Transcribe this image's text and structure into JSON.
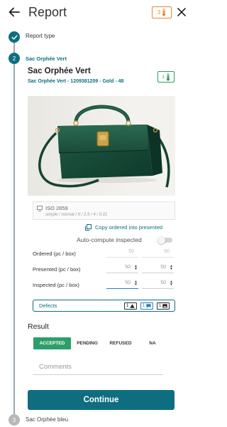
{
  "header": {
    "title": "Report",
    "badge_count": "3",
    "back_icon": "arrow-left-icon",
    "close_icon": "close-icon",
    "badge_color": "#e8892e"
  },
  "steps": [
    {
      "index": "1",
      "label": "Report type",
      "state": "done"
    },
    {
      "index": "2",
      "label": "Sac Orphée Vert",
      "state": "active"
    },
    {
      "index": "3",
      "label": "Sac Orphée bleu",
      "state": "pending"
    }
  ],
  "product": {
    "name": "Sac Orphée Vert",
    "subtitle": "Sac Orphée Vert - 1209381209 - Gold - 48",
    "badge_count": "1",
    "badge_color": "#2e9e5a",
    "image_icon": "green-handbag-image"
  },
  "iso": {
    "title": "ISO 2859",
    "details": "simple / normal / II / 2.5 / 4 / 0.01"
  },
  "copy_action": {
    "label": "Copy ordered into presented"
  },
  "auto_compute": {
    "label": "Auto-compute inspected",
    "enabled": false
  },
  "quantities": {
    "ordered": {
      "label": "Ordered (pc / box)",
      "pc": "50",
      "box": "50"
    },
    "presented": {
      "label": "Presented (pc / box)",
      "pc": "50",
      "box": "50"
    },
    "inspected": {
      "label": "Inspected (pc / box)",
      "pc": "50",
      "box": "50"
    }
  },
  "defects": {
    "label": "Defects",
    "buttons": [
      {
        "count": "1",
        "icon": "warning-triangle-icon"
      },
      {
        "count": "1",
        "icon": "comment-icon"
      },
      {
        "count": "1",
        "icon": "image-icon"
      }
    ]
  },
  "result": {
    "title": "Result",
    "options": [
      "ACCEPTED",
      "PENDING",
      "REFUSED",
      "NA"
    ],
    "selected": "ACCEPTED",
    "accept_color": "#2e9e68"
  },
  "comments": {
    "placeholder": "Comments"
  },
  "continue": {
    "label": "Continue"
  },
  "colors": {
    "primary": "#0e6e80",
    "link": "#2e7fb8"
  }
}
